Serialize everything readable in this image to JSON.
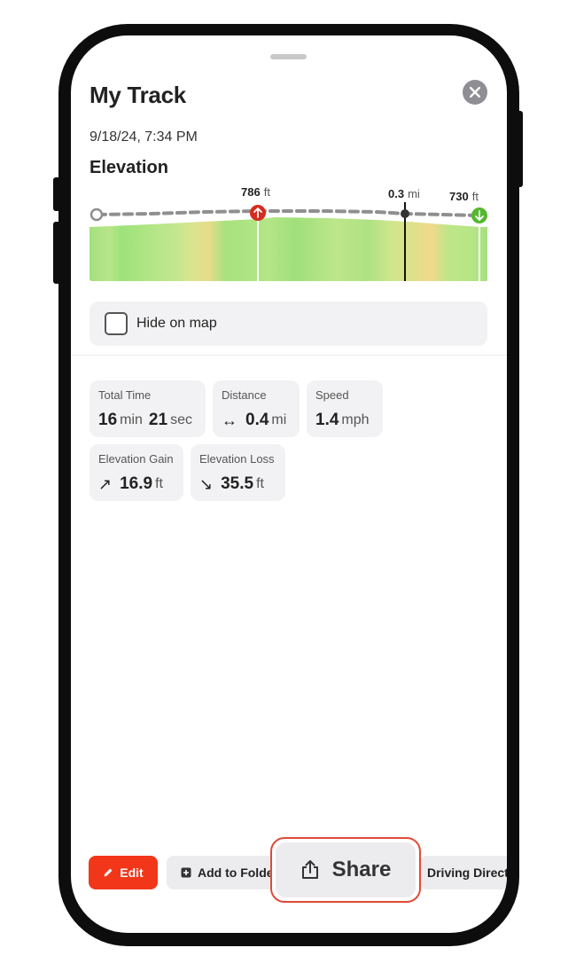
{
  "sheet": {
    "title": "My Track",
    "date": "9/18/24, 7:34 PM"
  },
  "elevation": {
    "heading": "Elevation",
    "high": {
      "value": "786",
      "unit": "ft"
    },
    "cursor": {
      "value": "0.3",
      "unit": "mi"
    },
    "end": {
      "value": "730",
      "unit": "ft"
    }
  },
  "hide_on_map": {
    "label": "Hide on map",
    "checked": false
  },
  "stats": {
    "total_time": {
      "label": "Total Time",
      "min": "16",
      "min_unit": "min",
      "sec": "21",
      "sec_unit": "sec"
    },
    "distance": {
      "label": "Distance",
      "arrow": "↔",
      "value": "0.4",
      "unit": "mi"
    },
    "speed": {
      "label": "Speed",
      "value": "1.4",
      "unit": "mph"
    },
    "elevation_gain": {
      "label": "Elevation Gain",
      "arrow": "↗",
      "value": "16.9",
      "unit": "ft"
    },
    "elevation_loss": {
      "label": "Elevation Loss",
      "arrow": "↘",
      "value": "35.5",
      "unit": "ft"
    }
  },
  "toolbar": {
    "edit_label": "Edit",
    "add_folder_label": "Add to Folder",
    "share_label": "Share",
    "driving_label": "Driving Directions"
  },
  "colors": {
    "accent_red": "#f2361a",
    "highlight_outline": "#e04b38",
    "end_marker_green": "#53b82d",
    "high_marker_red": "#d62b1f"
  }
}
